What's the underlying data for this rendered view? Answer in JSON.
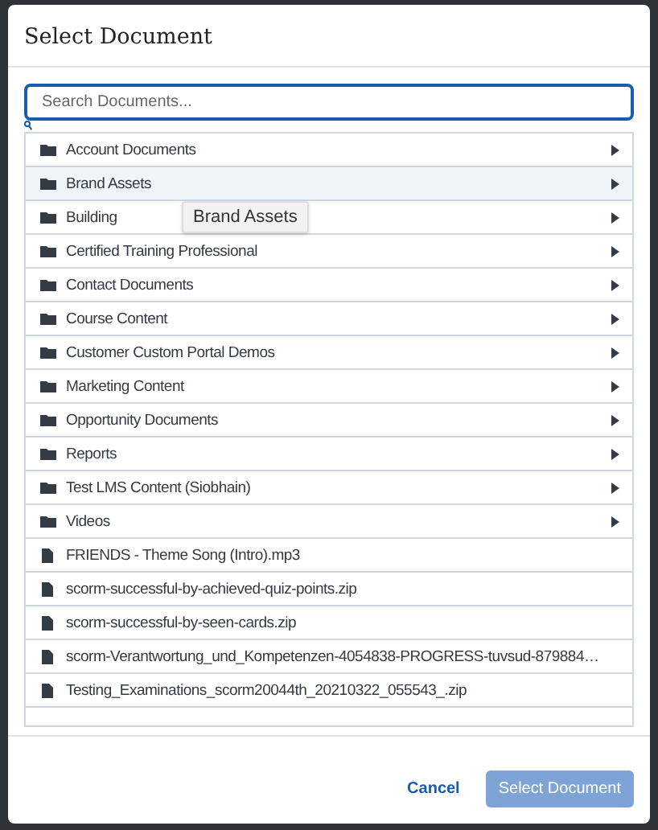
{
  "dialog": {
    "title": "Select Document"
  },
  "search": {
    "placeholder": "Search Documents..."
  },
  "items": [
    {
      "kind": "folder",
      "label": "Account Documents",
      "hovered": false
    },
    {
      "kind": "folder",
      "label": "Brand Assets",
      "hovered": true
    },
    {
      "kind": "folder",
      "label": "Building",
      "hovered": false
    },
    {
      "kind": "folder",
      "label": "Certified Training Professional",
      "hovered": false
    },
    {
      "kind": "folder",
      "label": "Contact Documents",
      "hovered": false
    },
    {
      "kind": "folder",
      "label": "Course Content",
      "hovered": false
    },
    {
      "kind": "folder",
      "label": "Customer Custom Portal Demos",
      "hovered": false
    },
    {
      "kind": "folder",
      "label": "Marketing Content",
      "hovered": false
    },
    {
      "kind": "folder",
      "label": "Opportunity Documents",
      "hovered": false
    },
    {
      "kind": "folder",
      "label": "Reports",
      "hovered": false
    },
    {
      "kind": "folder",
      "label": "Test LMS Content (Siobhain)",
      "hovered": false
    },
    {
      "kind": "folder",
      "label": "Videos",
      "hovered": false
    },
    {
      "kind": "file",
      "label": "FRIENDS - Theme Song (Intro).mp3",
      "hovered": false
    },
    {
      "kind": "file",
      "label": "scorm-successful-by-achieved-quiz-points.zip",
      "hovered": false
    },
    {
      "kind": "file",
      "label": "scorm-successful-by-seen-cards.zip",
      "hovered": false
    },
    {
      "kind": "file",
      "label": "scorm-Verantwortung_und_Kompetenzen-4054838-PROGRESS-tuvsud-879884…",
      "hovered": false
    },
    {
      "kind": "file",
      "label": "Testing_Examinations_scorm20044th_20210322_055543_.zip",
      "hovered": false
    }
  ],
  "tooltip": {
    "text": "Brand Assets"
  },
  "buttons": [
    {
      "kind": "link",
      "label": "Cancel",
      "disabled": false
    },
    {
      "kind": "primary",
      "label": "Select Document",
      "disabled": true
    }
  ]
}
